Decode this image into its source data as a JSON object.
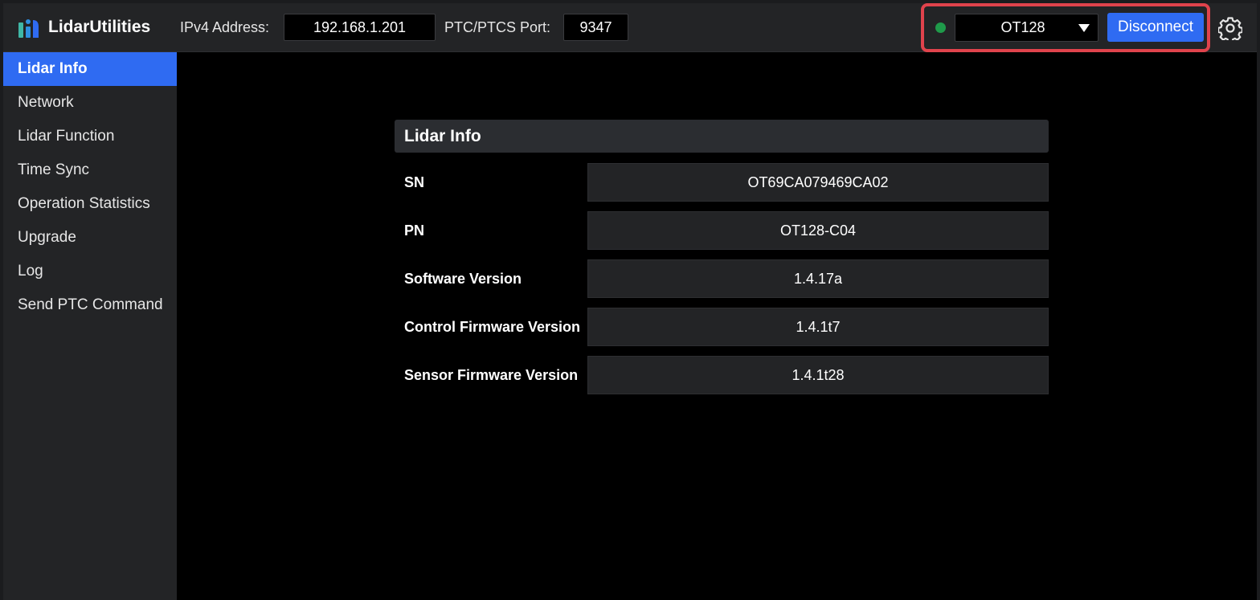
{
  "app": {
    "title": "LidarUtilities"
  },
  "header": {
    "ipv4_label": "IPv4 Address:",
    "ipv4_value": "192.168.1.201",
    "port_label": "PTC/PTCS Port:",
    "port_value": "9347",
    "status_color": "#1f9a4a",
    "model_selected": "OT128",
    "disconnect_label": "Disconnect",
    "settings_icon": "gear-icon"
  },
  "sidebar": {
    "items": [
      {
        "label": "Lidar Info",
        "active": true
      },
      {
        "label": "Network"
      },
      {
        "label": "Lidar Function"
      },
      {
        "label": "Time Sync"
      },
      {
        "label": "Operation Statistics"
      },
      {
        "label": "Upgrade"
      },
      {
        "label": "Log"
      },
      {
        "label": "Send PTC Command"
      }
    ]
  },
  "lidar_info": {
    "title": "Lidar Info",
    "rows": [
      {
        "label": "SN",
        "value": "OT69CA079469CA02"
      },
      {
        "label": "PN",
        "value": "OT128-C04"
      },
      {
        "label": "Software Version",
        "value": "1.4.17a"
      },
      {
        "label": "Control Firmware Version",
        "value": "1.4.1t7"
      },
      {
        "label": "Sensor Firmware Version",
        "value": "1.4.1t28"
      }
    ]
  },
  "colors": {
    "accent": "#2f6bf2",
    "highlight_border": "#e0434c"
  }
}
